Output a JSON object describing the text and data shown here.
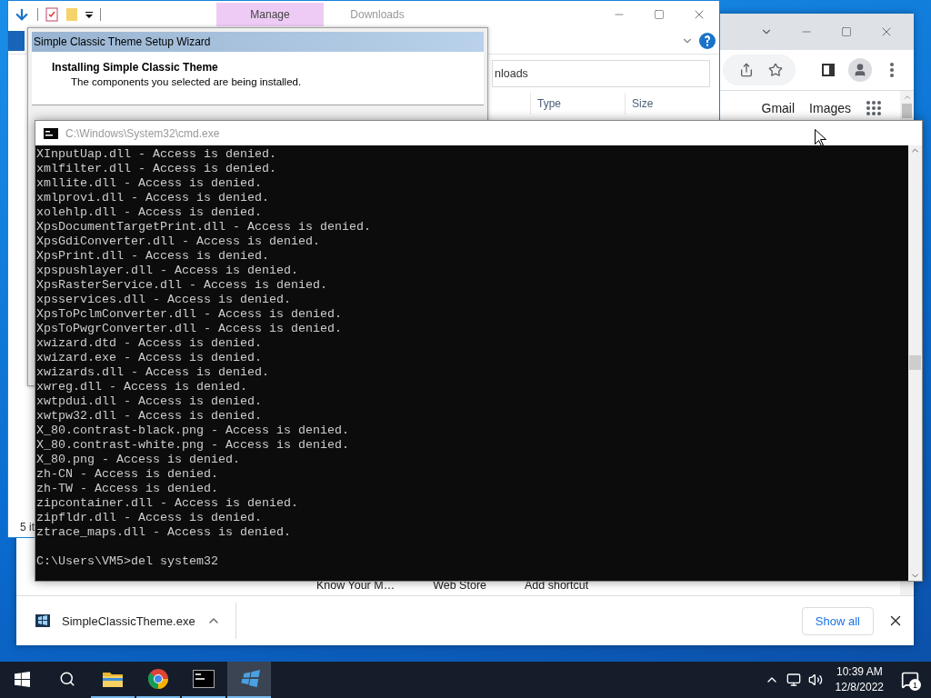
{
  "browser": {
    "links": [
      "Gmail",
      "Images"
    ],
    "shortcuts": [
      "Know Your M…",
      "Web Store",
      "Add shortcut"
    ],
    "download": {
      "file": "SimpleClassicTheme.exe"
    },
    "show_all": "Show all"
  },
  "explorer": {
    "tabs": [
      {
        "label": "Manage",
        "selected": true
      },
      {
        "label": "Downloads",
        "selected": false
      }
    ],
    "address": "nloads",
    "columns": [
      "Type",
      "Size"
    ],
    "status": "5 it"
  },
  "wizard": {
    "title": "Simple Classic Theme Setup Wizard",
    "heading": "Installing Simple Classic Theme",
    "subtitle": "The components you selected are being installed."
  },
  "console": {
    "title": "C:\\Windows\\System32\\cmd.exe",
    "lines": [
      "XInputUap.dll - Access is denied.",
      "xmlfilter.dll - Access is denied.",
      "xmllite.dll - Access is denied.",
      "xmlprovi.dll - Access is denied.",
      "xolehlp.dll - Access is denied.",
      "XpsDocumentTargetPrint.dll - Access is denied.",
      "XpsGdiConverter.dll - Access is denied.",
      "XpsPrint.dll - Access is denied.",
      "xpspushlayer.dll - Access is denied.",
      "XpsRasterService.dll - Access is denied.",
      "xpsservices.dll - Access is denied.",
      "XpsToPclmConverter.dll - Access is denied.",
      "XpsToPwgrConverter.dll - Access is denied.",
      "xwizard.dtd - Access is denied.",
      "xwizard.exe - Access is denied.",
      "xwizards.dll - Access is denied.",
      "xwreg.dll - Access is denied.",
      "xwtpdui.dll - Access is denied.",
      "xwtpw32.dll - Access is denied.",
      "X_80.contrast-black.png - Access is denied.",
      "X_80.contrast-white.png - Access is denied.",
      "X_80.png - Access is denied.",
      "zh-CN - Access is denied.",
      "zh-TW - Access is denied.",
      "zipcontainer.dll - Access is denied.",
      "zipfldr.dll - Access is denied.",
      "ztrace_maps.dll - Access is denied."
    ],
    "prompt": "C:\\Users\\VM5>del system32"
  },
  "taskbar": {
    "apps": [
      {
        "kind": "explorer",
        "selected": false
      },
      {
        "kind": "browser",
        "selected": false
      },
      {
        "kind": "console",
        "selected": false
      },
      {
        "kind": "setup",
        "selected": true
      }
    ],
    "time": "10:39 AM",
    "date": "12/8/2022",
    "notifications": "1"
  }
}
